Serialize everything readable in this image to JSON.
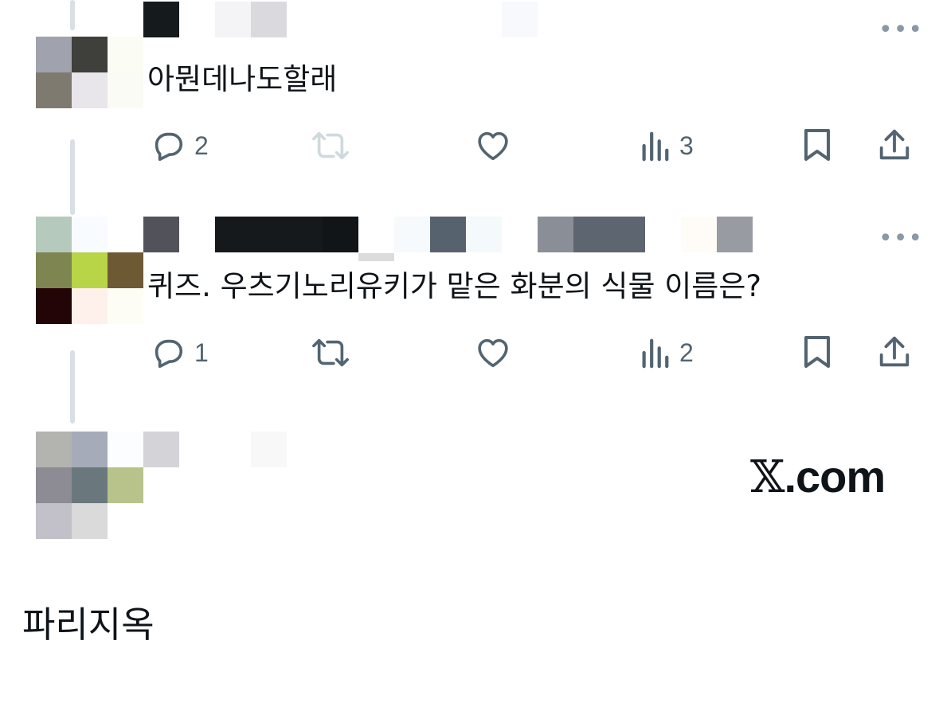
{
  "tweets": [
    {
      "text": "아뭔데나도할래",
      "actions": {
        "replies": "2",
        "retweets": "",
        "likes": "",
        "views": "3"
      }
    },
    {
      "text": "퀴즈. 우츠기노리유키가 맡은 화분의 식물 이름은?",
      "actions": {
        "replies": "1",
        "retweets": "",
        "likes": "",
        "views": "2"
      }
    }
  ],
  "watermark": {
    "x": "𝕏",
    "domain": ".com"
  },
  "caption": "파리지옥",
  "icons": {
    "more": "more-dots-icon",
    "reply": "reply-icon",
    "retweet": "retweet-icon",
    "like": "heart-icon",
    "views": "views-chart-icon",
    "bookmark": "bookmark-icon",
    "share": "share-icon"
  },
  "colors": {
    "text": "#0f1419",
    "secondary": "#536471",
    "retweet_disabled": "#cfd9de",
    "thread_line": "#d9dfe4"
  }
}
